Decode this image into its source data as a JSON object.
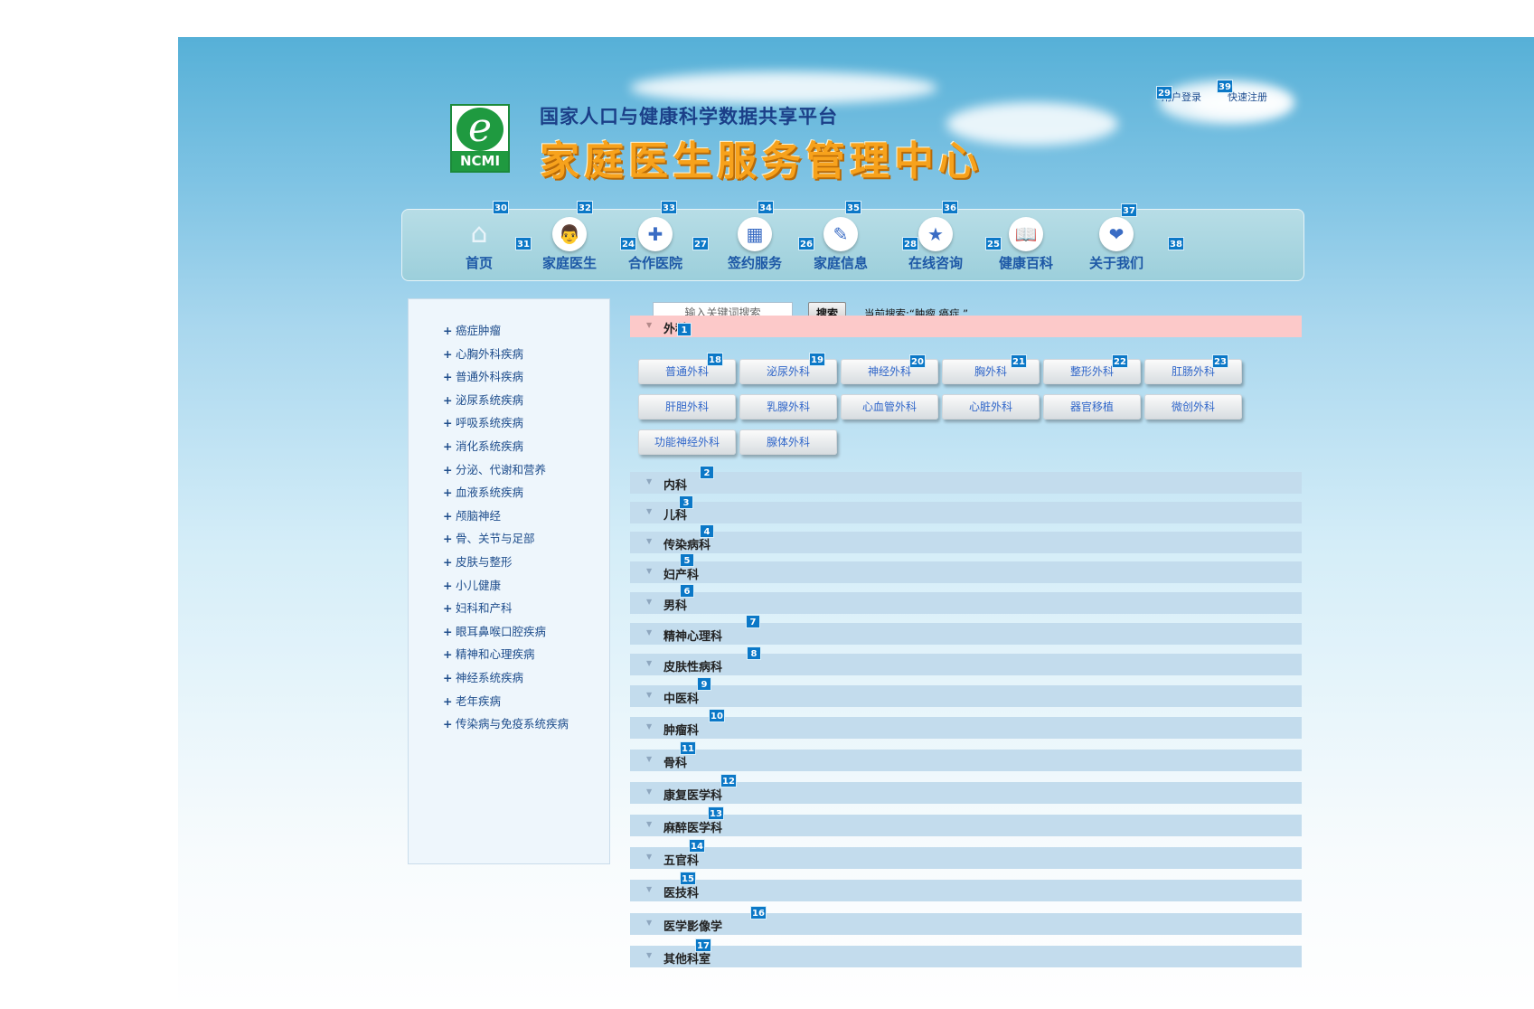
{
  "header": {
    "logo_mark": "e",
    "logo_text": "NCMI",
    "subtitle": "国家人口与健康科学数据共享平台",
    "title": "家庭医生服务管理中心",
    "login": "用户登录",
    "register": "快速注册"
  },
  "nav": [
    {
      "label": "首页",
      "icon": "home-icon"
    },
    {
      "label": "家庭医生",
      "icon": "doctor-icon"
    },
    {
      "label": "合作医院",
      "icon": "hospital-kit-icon"
    },
    {
      "label": "签约服务",
      "icon": "calendar-icon"
    },
    {
      "label": "家庭信息",
      "icon": "id-card-icon"
    },
    {
      "label": "在线咨询",
      "icon": "star-badge-icon"
    },
    {
      "label": "健康百科",
      "icon": "book-icon"
    },
    {
      "label": "关于我们",
      "icon": "handshake-icon"
    }
  ],
  "sidebar": {
    "items": [
      "癌症肿瘤",
      "心胸外科疾病",
      "普通外科疾病",
      "泌尿系统疾病",
      "呼吸系统疾病",
      "消化系统疾病",
      "分泌、代谢和营养",
      "血液系统疾病",
      "颅脑神经",
      "骨、关节与足部",
      "皮肤与整形",
      "小儿健康",
      "妇科和产科",
      "眼耳鼻喉口腔疾病",
      "精神和心理疾病",
      "神经系统疾病",
      "老年疾病",
      "传染病与免疫系统疾病"
    ]
  },
  "search": {
    "placeholder": "输入关键词搜索",
    "button": "搜索",
    "current": "当前搜索:“肿瘤 癌症 ”"
  },
  "sections": [
    {
      "label": "外科",
      "expanded": true,
      "children": [
        "普通外科",
        "泌尿外科",
        "神经外科",
        "胸外科",
        "整形外科",
        "肛肠外科",
        "肝胆外科",
        "乳腺外科",
        "心血管外科",
        "心脏外科",
        "器官移植",
        "微创外科",
        "功能神经外科",
        "腺体外科"
      ]
    },
    {
      "label": "内科"
    },
    {
      "label": "儿科"
    },
    {
      "label": "传染病科"
    },
    {
      "label": "妇产科"
    },
    {
      "label": "男科"
    },
    {
      "label": "精神心理科"
    },
    {
      "label": "皮肤性病科"
    },
    {
      "label": "中医科"
    },
    {
      "label": "肿瘤科"
    },
    {
      "label": "骨科"
    },
    {
      "label": "康复医学科"
    },
    {
      "label": "麻醉医学科"
    },
    {
      "label": "五官科"
    },
    {
      "label": "医技科"
    },
    {
      "label": "医学影像学"
    },
    {
      "label": "其他科室"
    }
  ],
  "badges": {
    "sections": [
      "1",
      "2",
      "3",
      "4",
      "5",
      "6",
      "7",
      "8",
      "9",
      "10",
      "11",
      "12",
      "13",
      "14",
      "15",
      "16",
      "17"
    ],
    "subs": [
      "18",
      "19",
      "20",
      "21",
      "22",
      "23"
    ],
    "nav": [
      "24",
      "25",
      "26",
      "27",
      "28",
      "29",
      "30",
      "31",
      "32",
      "33",
      "34",
      "35",
      "36",
      "37",
      "38",
      "39"
    ]
  },
  "colors": {
    "accent": "#0b78c7",
    "active_section": "#fcc9c9",
    "section": "#c3dced",
    "title_orange": "#f7a21c",
    "subtitle_blue": "#1b3f88"
  }
}
